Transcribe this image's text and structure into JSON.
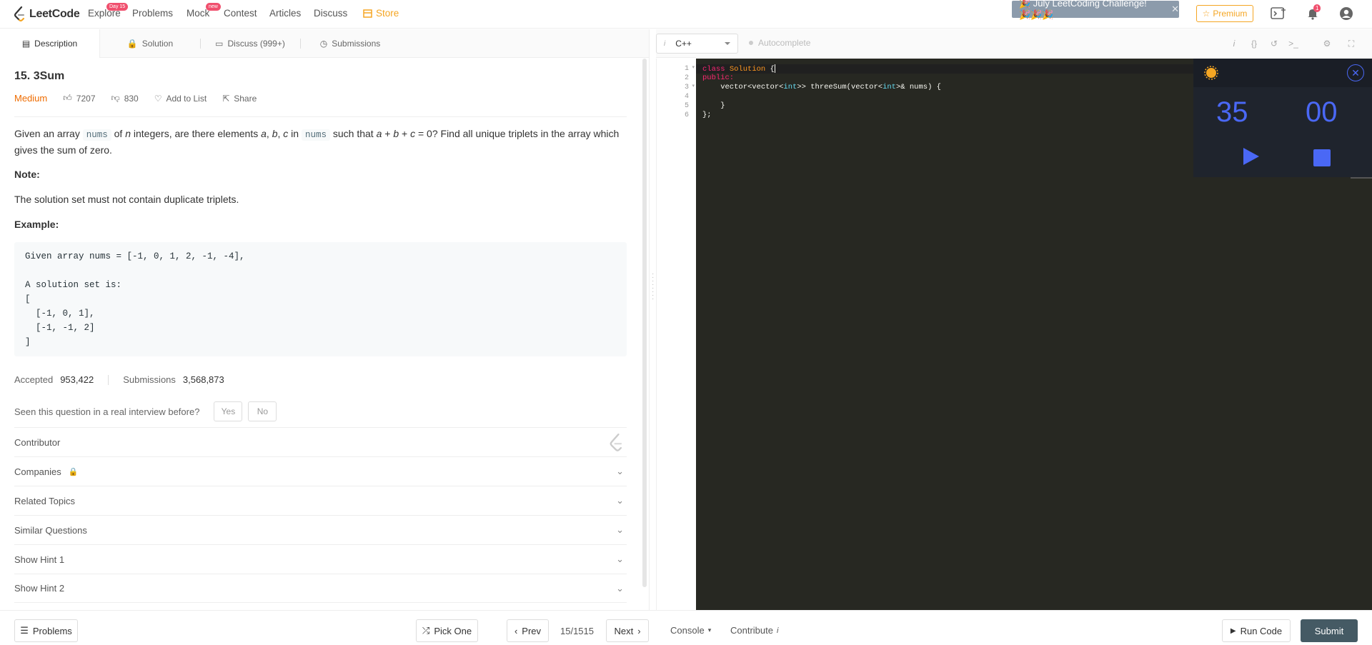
{
  "navbar": {
    "logo_text": "LeetCode",
    "items": [
      {
        "label": "Explore",
        "badge": "Day 15"
      },
      {
        "label": "Problems"
      },
      {
        "label": "Mock",
        "badge": "new"
      },
      {
        "label": "Contest"
      },
      {
        "label": "Articles"
      },
      {
        "label": "Discuss"
      },
      {
        "label": "Store"
      }
    ],
    "challenge_label": "🎉 July LeetCoding Challenge! 🎉🎉🎉",
    "premium_label": "Premium",
    "notification_count": "1"
  },
  "tabs": [
    {
      "label": "Description",
      "icon": "description-icon"
    },
    {
      "label": "Solution",
      "icon": "lock-icon"
    },
    {
      "label": "Discuss (999+)",
      "icon": "discuss-icon"
    },
    {
      "label": "Submissions",
      "icon": "history-icon"
    }
  ],
  "question": {
    "title": "15. 3Sum",
    "difficulty": "Medium",
    "likes": "7207",
    "dislikes": "830",
    "add_to_list": "Add to List",
    "share": "Share",
    "desc_part1": "Given an array ",
    "desc_code1": "nums",
    "desc_part2": " of ",
    "desc_n": "n",
    "desc_part3": " integers, are there elements ",
    "desc_abc": "a",
    "desc_part3b": ", ",
    "desc_b": "b",
    "desc_part3c": ", ",
    "desc_c": "c",
    "desc_part4": " in ",
    "desc_code2": "nums",
    "desc_part5": " such that ",
    "desc_eq": "a",
    "desc_part6": " + ",
    "desc_eq_b": "b",
    "desc_part7": " + ",
    "desc_eq_c": "c",
    "desc_part8": " = 0? Find all unique triplets in the array which gives the sum of zero.",
    "note_heading": "Note:",
    "note_text": "The solution set must not contain duplicate triplets.",
    "example_heading": "Example:",
    "example_code": "Given array nums = [-1, 0, 1, 2, -1, -4],\n\nA solution set is:\n[\n  [-1, 0, 1],\n  [-1, -1, 2]\n]",
    "accepted_label": "Accepted",
    "accepted_value": "953,422",
    "submissions_label": "Submissions",
    "submissions_value": "3,568,873",
    "interview_question": "Seen this question in a real interview before?",
    "yes_label": "Yes",
    "no_label": "No",
    "accordion": [
      {
        "label": "Contributor"
      },
      {
        "label": "Companies"
      },
      {
        "label": "Related Topics"
      },
      {
        "label": "Similar Questions"
      },
      {
        "label": "Show Hint 1"
      },
      {
        "label": "Show Hint 2"
      }
    ]
  },
  "editor": {
    "language": "C++",
    "autocomplete_label": "Autocomplete",
    "line_numbers": [
      "1",
      "2",
      "3",
      "4",
      "5",
      "6"
    ],
    "code": {
      "l1_kw": "class",
      "l1_name": "Solution",
      "l1_brace": " {",
      "l2": "public:",
      "l3_a": "    vector<vector<",
      "l3_int1": "int",
      "l3_b": ">> threeSum(vector<",
      "l3_int2": "int",
      "l3_c": ">& nums) {",
      "l4": "",
      "l5": "    }",
      "l6": "};"
    }
  },
  "timer": {
    "minutes": "35",
    "seconds": "00"
  },
  "bottom": {
    "problems_label": "Problems",
    "pick_one_label": "Pick One",
    "prev_label": "Prev",
    "page_indicator": "15/1515",
    "next_label": "Next",
    "console_label": "Console",
    "contribute_label": "Contribute",
    "run_code_label": "Run Code",
    "submit_label": "Submit"
  },
  "colors": {
    "accent": "#4a68f5",
    "difficulty_medium": "#ef6c00",
    "store": "#f5a623",
    "editor_bg": "#272822",
    "submit_bg": "#455a64"
  }
}
